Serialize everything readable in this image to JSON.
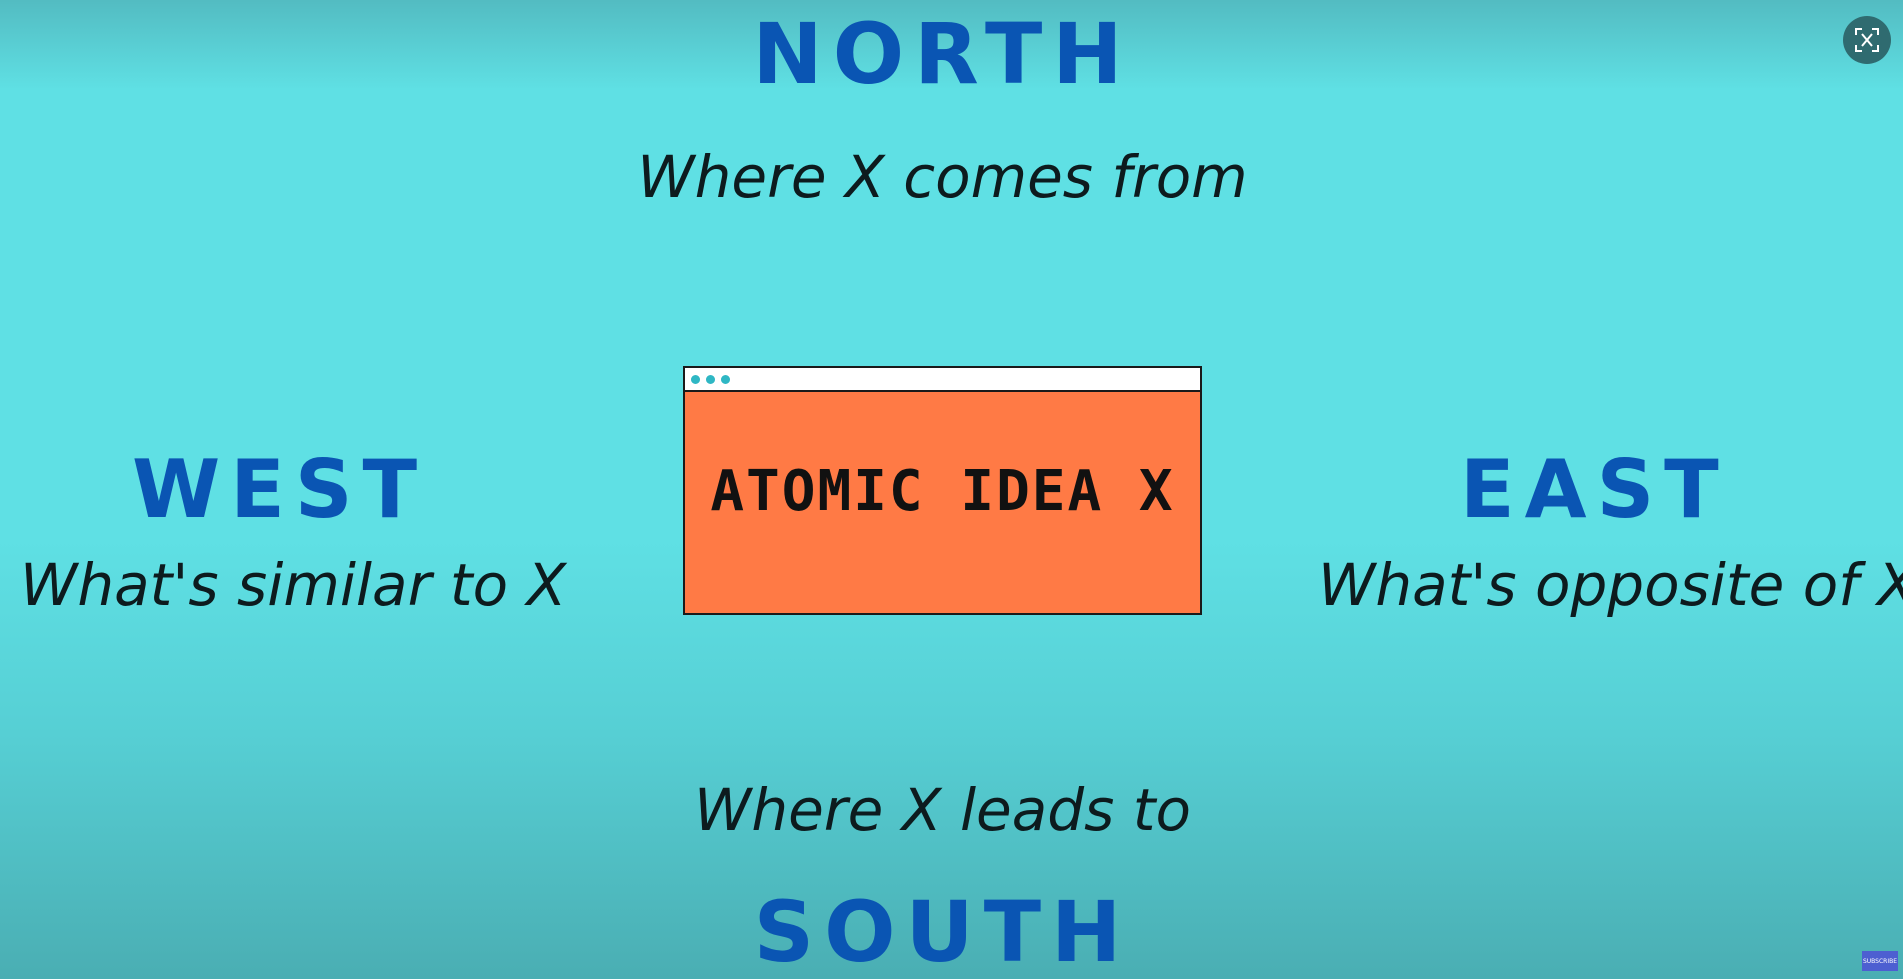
{
  "north": {
    "heading": "NORTH",
    "caption": "Where X comes from"
  },
  "west": {
    "heading": "WEST",
    "caption": "What's similar to X"
  },
  "east": {
    "heading": "EAST",
    "caption": "What's opposite of X"
  },
  "south": {
    "heading": "SOUTH",
    "caption": "Where X leads to"
  },
  "center_card": {
    "title": "ATOMIC IDEA X"
  },
  "subscribe_label": "SUBSCRIBE",
  "colors": {
    "background": "#5fe0e4",
    "heading": "#0a55b3",
    "card": "#ff7a45",
    "card_dots": "#2fb7c4",
    "subscribe": "#4d5fd1"
  },
  "icons": {
    "exit_fullscreen": "exit-fullscreen-icon"
  }
}
